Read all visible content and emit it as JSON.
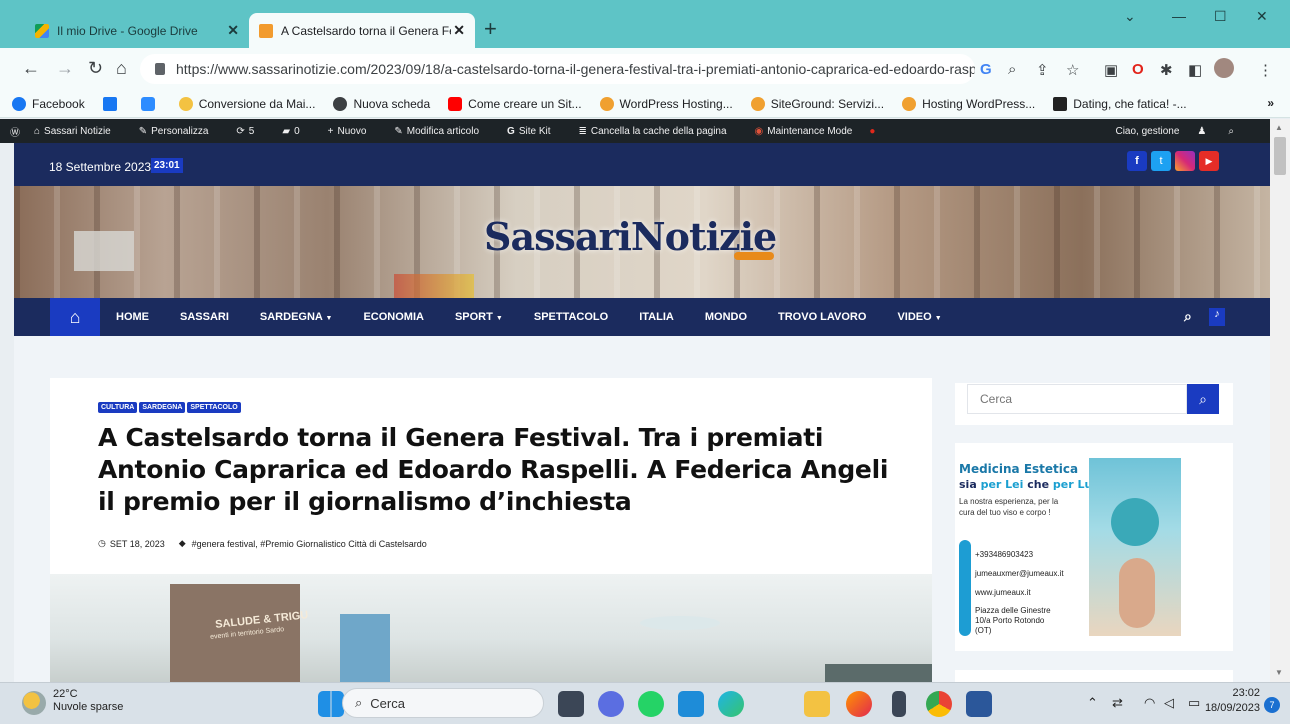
{
  "browser": {
    "tabs": [
      {
        "title": "Il mio Drive - Google Drive",
        "active": false
      },
      {
        "title": "A Castelsardo torna il Genera Fes",
        "active": true
      }
    ],
    "new_tab_symbol": "+",
    "url": "https://www.sassarinotizie.com/2023/09/18/a-castelsardo-torna-il-genera-festival-tra-i-premiati-antonio-caprarica-ed-edoardo-raspel...",
    "bookmarks": [
      "Facebook",
      "",
      "",
      "Conversione da Mai...",
      "Nuova scheda",
      "Come creare un Sit...",
      "WordPress Hosting...",
      "SiteGround: Servizi...",
      "Hosting WordPress...",
      "Dating, che fatica! -..."
    ],
    "bookmarks_more": "»"
  },
  "wp_admin_bar": {
    "site_name": "Sassari Notizie",
    "customize": "Personalizza",
    "updates": "5",
    "comments": "0",
    "new": "Nuovo",
    "edit": "Modifica articolo",
    "site_kit": "Site Kit",
    "cache": "Cancella la cache della pagina",
    "maintenance": "Maintenance Mode",
    "greeting": "Ciao, gestione"
  },
  "site": {
    "date": "18 Settembre 2023",
    "time": "23:01",
    "logo": "SassariNotizie",
    "nav": [
      "HOME",
      "SASSARI",
      "SARDEGNA",
      "ECONOMIA",
      "SPORT",
      "SPETTACOLO",
      "ITALIA",
      "MONDO",
      "TROVO LAVORO",
      "VIDEO"
    ],
    "nav_dropdowns": [
      "SARDEGNA",
      "SPORT",
      "VIDEO"
    ]
  },
  "article": {
    "categories": [
      "CULTURA",
      "SARDEGNA",
      "SPETTACOLO"
    ],
    "title": "A Castelsardo torna il Genera Festival. Tra i premiati Antonio Caprarica ed Edoardo Raspelli. A Federica Angeli il premio per il giornalismo d’inchiesta",
    "date": "SET 18, 2023",
    "tags": "#genera festival, #Premio Giornalistico Città di Castelsardo",
    "image_text": "SALUDE & TRIGU",
    "image_subtext": "eventi in territorio Sardo"
  },
  "sidebar": {
    "search_placeholder": "Cerca",
    "ad": {
      "headline1": "Medicina Estetica",
      "headline2a": "sia ",
      "headline2b": "per Lei",
      "headline2c": " che ",
      "headline2d": "per Lui",
      "body": "La nostra esperienza, per la cura del tuo viso e corpo !",
      "phone": "+393486903423",
      "email": "jumeauxmer@jumeaux.it",
      "web": "www.jumeaux.it",
      "address": "Piazza delle Ginestre 10/a Porto Rotondo (OT)"
    }
  },
  "taskbar": {
    "temp": "22°C",
    "weather": "Nuvole sparse",
    "search": "Cerca",
    "time": "23:02",
    "date": "18/09/2023",
    "notifications": "7"
  }
}
